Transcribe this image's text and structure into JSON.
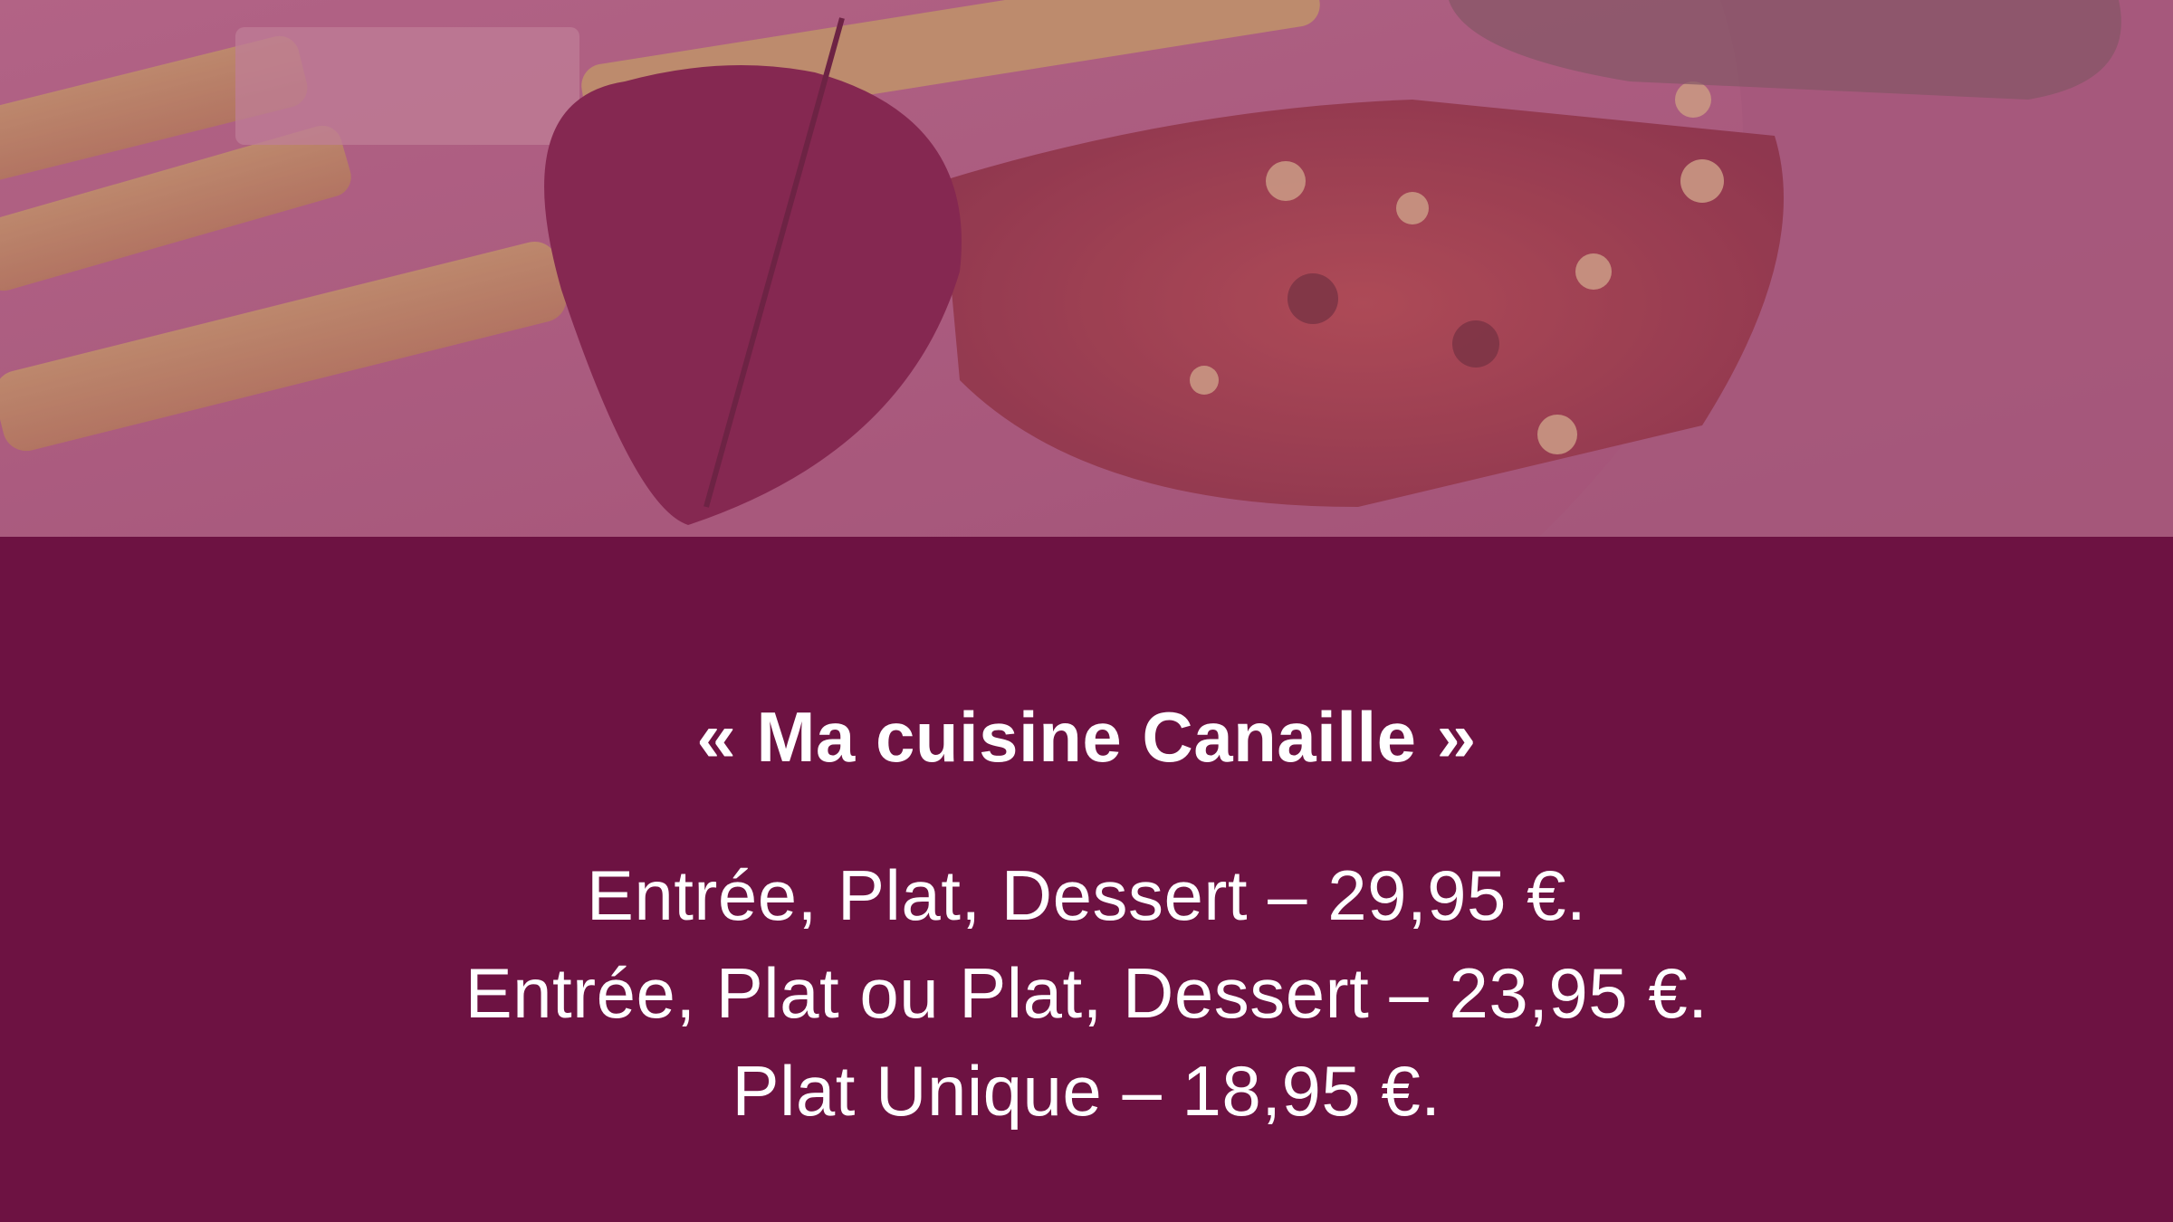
{
  "hero": {
    "image_description": "Close-up photo of a plated dish with glazed vegetable batons, a dark leaf and a terrine slice under a magenta overlay",
    "overlay_color": "#9e4a71"
  },
  "menu": {
    "title": "« Ma cuisine Canaille »",
    "prices": [
      "Entrée, Plat, Dessert – 29,95 €.",
      "Entrée, Plat ou Plat, Dessert – 23,95 €.",
      "Plat Unique – 18,95 €."
    ]
  },
  "colors": {
    "panel_background": "#6d1242",
    "text": "#ffffff"
  }
}
